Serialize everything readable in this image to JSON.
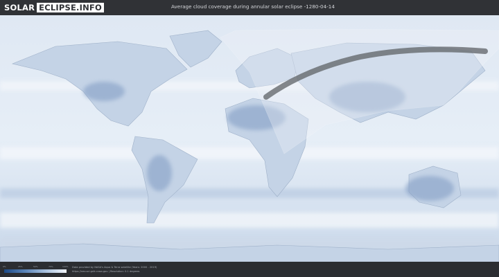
{
  "logo": {
    "part1": "SOLAR",
    "part2": "ECLIPSE.INFO"
  },
  "title": "Average cloud coverage during annular solar eclipse -1280-04-14",
  "legend": {
    "ticks": [
      "0%",
      "25%",
      "50%",
      "75%",
      "100%"
    ]
  },
  "credit": {
    "line1": "Data provided by NASA's Aqua & Terra satellite (Years: 2000 - 2019)",
    "line2": "https://neo.sci.gsfc.nasa.gov | Resolution: 0.1 degrees"
  },
  "colors": {
    "cloud_high": "#f2f6fb",
    "cloud_low": "#1d4a86",
    "header": "#303236",
    "eclipse_path": "#5e6166"
  }
}
